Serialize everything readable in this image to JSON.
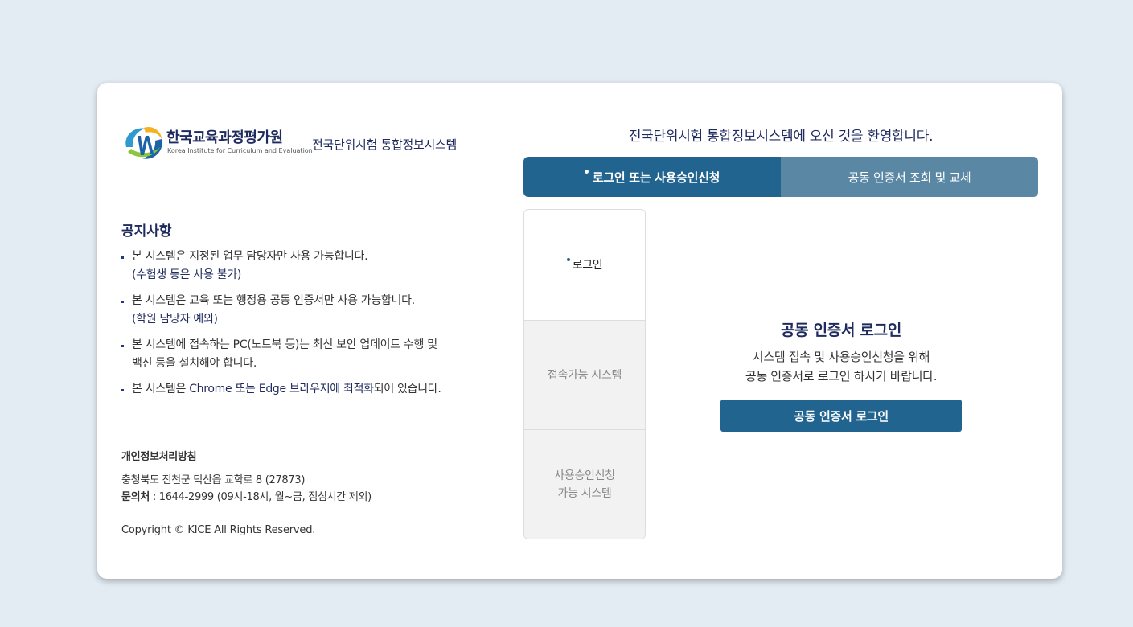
{
  "header": {
    "logo_korean": "한국교육과정평가원",
    "logo_english": "Korea Institute for Curriculum and Evaluation",
    "system_title": "전국단위시험 통합정보시스템"
  },
  "notice": {
    "title": "공지사항",
    "items": [
      {
        "line1": "본 시스템은 지정된 업무 담당자만 사용 가능합니다.",
        "line2": "(수험생 등은 사용 불가)"
      },
      {
        "line1": "본 시스템은 교육 또는 행정용 공동 인증서만 사용 가능합니다.",
        "line2": "(학원 담당자 예외)"
      },
      {
        "line1": "본 시스템에 접속하는 PC(노트북 등)는 최신 보안 업데이트 수행 및",
        "line2": "백신 등을 설치해야 합니다."
      },
      {
        "pre": "본 시스템은 ",
        "highlight": "Chrome 또는 Edge 브라우저에 최적화",
        "post": "되어 있습니다."
      }
    ]
  },
  "footer": {
    "privacy_link": "개인정보처리방침",
    "address": "충청북도 진천군 덕산읍 교학로 8 (27873)",
    "contact_label": "문의처",
    "contact_value": " : 1644-2999 (09시-18시, 월~금, 점심시간 제외)",
    "copyright": "Copyright © KICE All Rights Reserved."
  },
  "main": {
    "welcome": "전국단위시험 통합정보시스템에 오신 것을 환영합니다.",
    "tabs": [
      {
        "label": "로그인 또는 사용승인신청",
        "active": true
      },
      {
        "label": "공동 인증서 조회 및 교체",
        "active": false
      }
    ],
    "sidebar": {
      "login": "로그인",
      "accessible_systems": "접속가능 시스템",
      "approval_line1": "사용승인신청",
      "approval_line2": "가능 시스템"
    },
    "login": {
      "title": "공동 인증서 로그인",
      "desc_line1": "시스템 접속 및 사용승인신청을 위해",
      "desc_line2": "공동 인증서로 로그인 하시기 바랍니다.",
      "button": "공동 인증서 로그인"
    }
  },
  "colors": {
    "primary": "#20648f",
    "tab_inactive": "#5a87a3",
    "navy_text": "#1f2a5e",
    "background": "#e3ebf3"
  },
  "icons": [
    "kice-logo-icon"
  ]
}
